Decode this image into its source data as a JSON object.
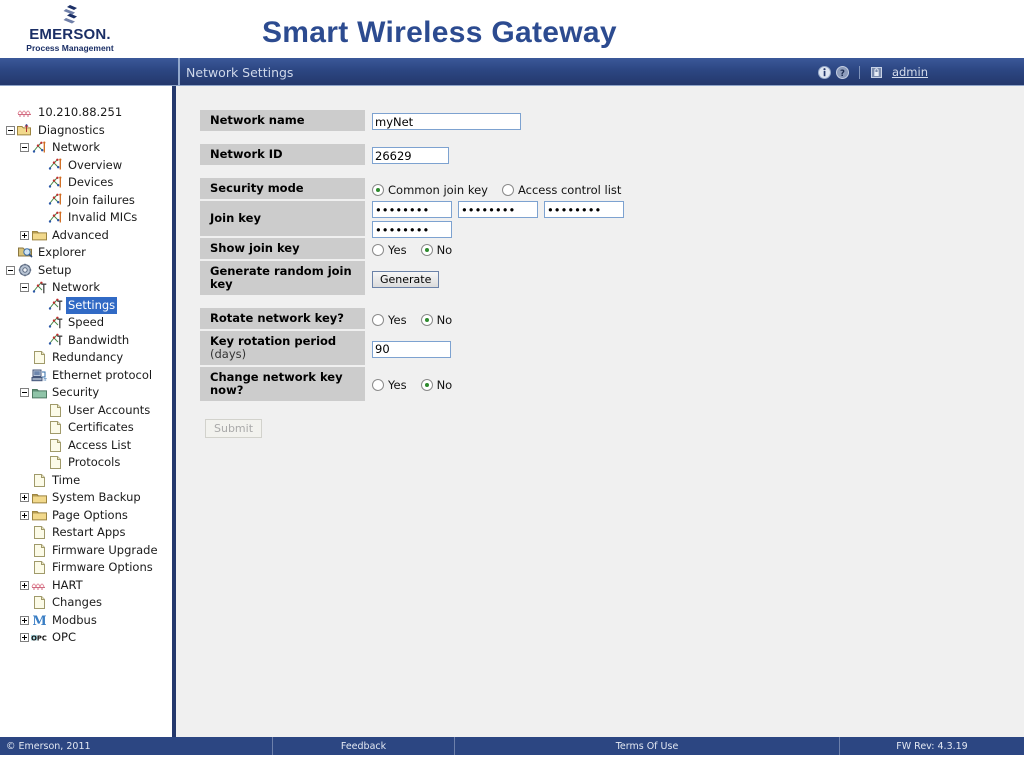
{
  "branding": {
    "company": "EMERSON.",
    "tagline": "Process Management",
    "app_title": "Smart Wireless Gateway"
  },
  "header": {
    "page_tab": "Network Settings",
    "info_icon": "info-icon",
    "help_icon": "help-icon",
    "lock_icon": "lock-icon",
    "user": "admin"
  },
  "sidebar": {
    "nodes": [
      {
        "label": "10.210.88.251",
        "depth": 0,
        "expander": "none",
        "icon": "hart-icon",
        "selected": false
      },
      {
        "label": "Diagnostics",
        "depth": 0,
        "expander": "minus",
        "icon": "folder-diag-icon",
        "selected": false
      },
      {
        "label": "Network",
        "depth": 1,
        "expander": "minus",
        "icon": "network-icon",
        "selected": false
      },
      {
        "label": "Overview",
        "depth": 2,
        "expander": "none",
        "icon": "network-icon",
        "selected": false
      },
      {
        "label": "Devices",
        "depth": 2,
        "expander": "none",
        "icon": "network-icon",
        "selected": false
      },
      {
        "label": "Join failures",
        "depth": 2,
        "expander": "none",
        "icon": "network-icon",
        "selected": false
      },
      {
        "label": "Invalid MICs",
        "depth": 2,
        "expander": "none",
        "icon": "network-icon",
        "selected": false
      },
      {
        "label": "Advanced",
        "depth": 1,
        "expander": "plus",
        "icon": "folder-icon",
        "selected": false
      },
      {
        "label": "Explorer",
        "depth": 0,
        "expander": "none",
        "icon": "explorer-icon",
        "selected": false
      },
      {
        "label": "Setup",
        "depth": 0,
        "expander": "minus",
        "icon": "gear-icon",
        "selected": false
      },
      {
        "label": "Network",
        "depth": 1,
        "expander": "minus",
        "icon": "network-t-icon",
        "selected": false
      },
      {
        "label": "Settings",
        "depth": 2,
        "expander": "none",
        "icon": "network-t-icon",
        "selected": true
      },
      {
        "label": "Speed",
        "depth": 2,
        "expander": "none",
        "icon": "network-t-icon",
        "selected": false
      },
      {
        "label": "Bandwidth",
        "depth": 2,
        "expander": "none",
        "icon": "network-t-icon",
        "selected": false
      },
      {
        "label": "Redundancy",
        "depth": 1,
        "expander": "none",
        "icon": "page-icon",
        "selected": false
      },
      {
        "label": "Ethernet protocol",
        "depth": 1,
        "expander": "none",
        "icon": "ethernet-icon",
        "selected": false
      },
      {
        "label": "Security",
        "depth": 1,
        "expander": "minus",
        "icon": "folder-security-icon",
        "selected": false
      },
      {
        "label": "User Accounts",
        "depth": 2,
        "expander": "none",
        "icon": "page-icon",
        "selected": false
      },
      {
        "label": "Certificates",
        "depth": 2,
        "expander": "none",
        "icon": "page-icon",
        "selected": false
      },
      {
        "label": "Access List",
        "depth": 2,
        "expander": "none",
        "icon": "page-icon",
        "selected": false
      },
      {
        "label": "Protocols",
        "depth": 2,
        "expander": "none",
        "icon": "page-icon",
        "selected": false
      },
      {
        "label": "Time",
        "depth": 1,
        "expander": "none",
        "icon": "page-icon",
        "selected": false
      },
      {
        "label": "System Backup",
        "depth": 1,
        "expander": "plus",
        "icon": "folder-icon",
        "selected": false
      },
      {
        "label": "Page Options",
        "depth": 1,
        "expander": "plus",
        "icon": "folder-icon",
        "selected": false
      },
      {
        "label": "Restart Apps",
        "depth": 1,
        "expander": "none",
        "icon": "page-icon",
        "selected": false
      },
      {
        "label": "Firmware Upgrade",
        "depth": 1,
        "expander": "none",
        "icon": "page-icon",
        "selected": false
      },
      {
        "label": "Firmware Options",
        "depth": 1,
        "expander": "none",
        "icon": "page-icon",
        "selected": false
      },
      {
        "label": "HART",
        "depth": 1,
        "expander": "plus",
        "icon": "hart-icon",
        "selected": false
      },
      {
        "label": "Changes",
        "depth": 1,
        "expander": "none",
        "icon": "page-icon",
        "selected": false
      },
      {
        "label": "Modbus",
        "depth": 1,
        "expander": "plus",
        "icon": "modbus-icon",
        "selected": false
      },
      {
        "label": "OPC",
        "depth": 1,
        "expander": "plus",
        "icon": "opc-icon",
        "selected": false
      }
    ]
  },
  "form": {
    "network_name": {
      "label": "Network name",
      "value": "myNet"
    },
    "network_id": {
      "label": "Network ID",
      "value": "26629"
    },
    "security_mode": {
      "label": "Security mode",
      "options": [
        "Common join key",
        "Access control list"
      ],
      "selected": "Common join key"
    },
    "join_key": {
      "label": "Join key",
      "values": [
        "••••••••",
        "••••••••",
        "••••••••",
        "••••••••"
      ]
    },
    "show_join_key": {
      "label": "Show join key",
      "options": [
        "Yes",
        "No"
      ],
      "selected": "No"
    },
    "generate_random_join_key": {
      "label": "Generate random join key",
      "button": "Generate"
    },
    "rotate_network_key": {
      "label": "Rotate network key?",
      "options": [
        "Yes",
        "No"
      ],
      "selected": "No"
    },
    "key_rotation_period": {
      "label": "Key rotation period",
      "sublabel": "(days)",
      "value": "90"
    },
    "change_network_key_now": {
      "label": "Change network key now?",
      "options": [
        "Yes",
        "No"
      ],
      "selected": "No"
    },
    "submit": {
      "label": "Submit",
      "enabled": false
    }
  },
  "footer": {
    "copyright": "© Emerson, 2011",
    "feedback": "Feedback",
    "terms": "Terms Of Use",
    "fw_rev": "FW Rev: 4.3.19"
  },
  "colors": {
    "header_blue": "#2c4682",
    "title_blue": "#2c4b90",
    "selection_blue": "#316ac5",
    "label_grey": "#cccccc",
    "content_grey": "#f0f0f0",
    "radio_green": "#2e8b2e"
  }
}
